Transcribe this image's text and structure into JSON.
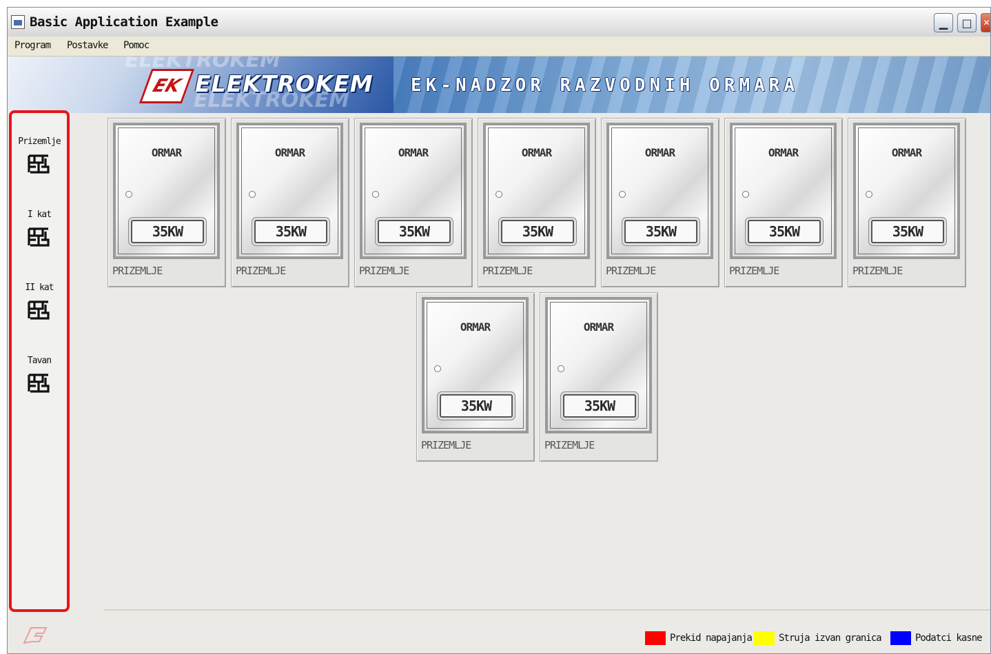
{
  "window": {
    "title": "Basic Application Example",
    "controls": [
      "minimize-icon",
      "maximize-icon",
      "close-icon"
    ]
  },
  "menu": {
    "items": [
      {
        "label": "Program"
      },
      {
        "label": "Postavke"
      },
      {
        "label": "Pomoc"
      }
    ]
  },
  "banner": {
    "logo_text": "ELEKTROKEM",
    "logo_mark": "EK",
    "title": "EK-NADZOR RAZVODNIH ORMARA"
  },
  "sidebar": {
    "items": [
      {
        "label": "Prizemlje",
        "icon": "floor-plan-icon"
      },
      {
        "label": "I kat",
        "icon": "floor-plan-icon"
      },
      {
        "label": "II kat",
        "icon": "floor-plan-icon"
      },
      {
        "label": "Tavan",
        "icon": "floor-plan-icon"
      }
    ]
  },
  "cabinets": [
    {
      "title": "ORMAR",
      "power": "35KW",
      "location": "PRIZEMLJE"
    },
    {
      "title": "ORMAR",
      "power": "35KW",
      "location": "PRIZEMLJE"
    },
    {
      "title": "ORMAR",
      "power": "35KW",
      "location": "PRIZEMLJE"
    },
    {
      "title": "ORMAR",
      "power": "35KW",
      "location": "PRIZEMLJE"
    },
    {
      "title": "ORMAR",
      "power": "35KW",
      "location": "PRIZEMLJE"
    },
    {
      "title": "ORMAR",
      "power": "35KW",
      "location": "PRIZEMLJE"
    },
    {
      "title": "ORMAR",
      "power": "35KW",
      "location": "PRIZEMLJE"
    },
    {
      "title": "ORMAR",
      "power": "35KW",
      "location": "PRIZEMLJE"
    },
    {
      "title": "ORMAR",
      "power": "35KW",
      "location": "PRIZEMLJE"
    }
  ],
  "legend": [
    {
      "label": "Prekid napajanja",
      "color": "#ff0000"
    },
    {
      "label": "Struja izvan granica",
      "color": "#ffff00"
    },
    {
      "label": "Podatci kasne",
      "color": "#0000ff"
    }
  ],
  "colors": {
    "sidebar_border": "#e8141a",
    "banner_blue": "#2858a6"
  }
}
